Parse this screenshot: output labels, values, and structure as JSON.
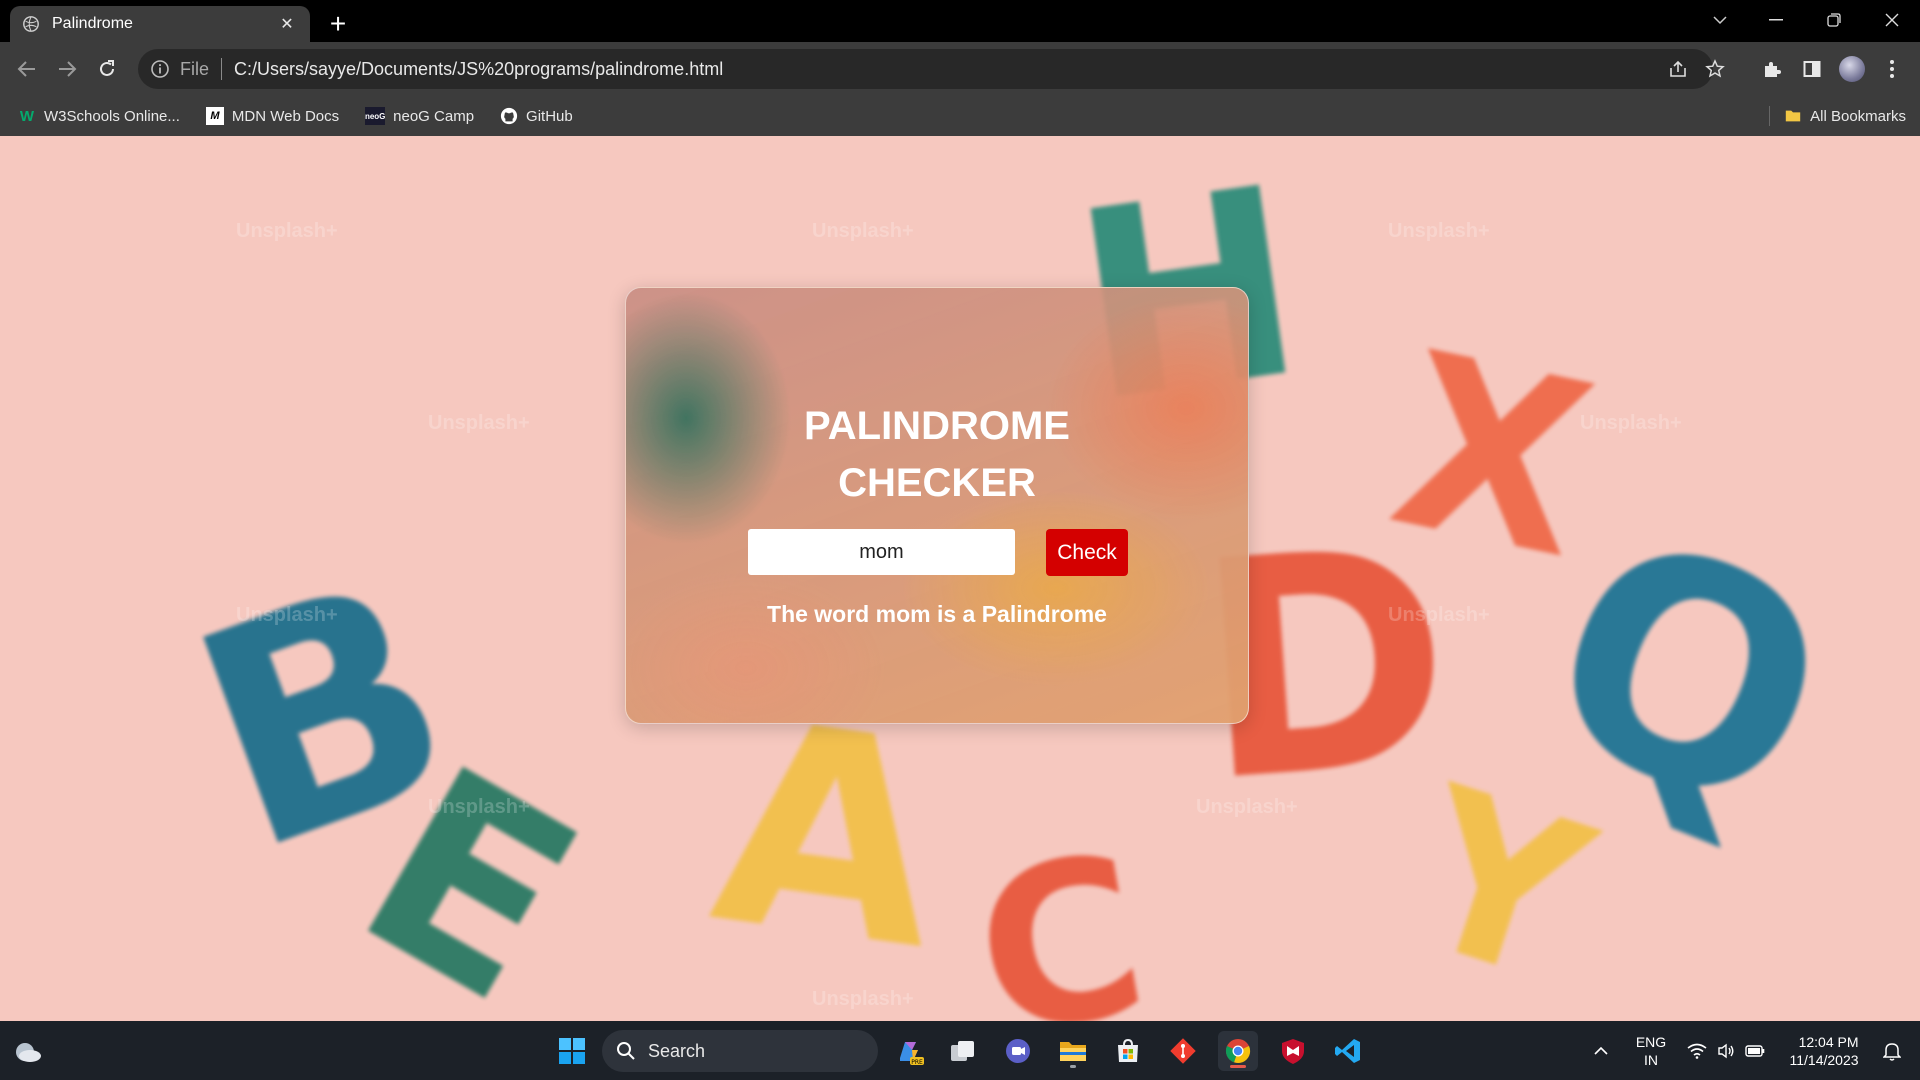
{
  "browser": {
    "tab_title": "Palindrome",
    "url_scheme": "File",
    "url": "C:/Users/sayye/Documents/JS%20programs/palindrome.html",
    "bookmarks": [
      {
        "label": "W3Schools Online...",
        "icon": "w3schools-icon"
      },
      {
        "label": "MDN Web Docs",
        "icon": "mdn-icon"
      },
      {
        "label": "neoG Camp",
        "icon": "neog-icon"
      },
      {
        "label": "GitHub",
        "icon": "github-icon"
      }
    ],
    "all_bookmarks_label": "All Bookmarks"
  },
  "page": {
    "title_line1": "PALINDROME",
    "title_line2": "CHECKER",
    "input_value": "mom",
    "button_label": "Check",
    "result": "The word mom is a Palindrome",
    "background_watermark": "Unsplash+",
    "background_letters": [
      "H",
      "B",
      "A",
      "D",
      "C",
      "X",
      "Y",
      "E",
      "Q"
    ],
    "accent_color": "#d40000"
  },
  "taskbar": {
    "search_label": "Search",
    "apps": [
      "windows-start-icon",
      "search-icon",
      "copilot-icon",
      "task-view-icon",
      "teams-icon",
      "file-explorer-icon",
      "microsoft-store-icon",
      "git-icon",
      "chrome-icon",
      "mcafee-icon",
      "vscode-icon"
    ],
    "language_line1": "ENG",
    "language_line2": "IN",
    "time": "12:04 PM",
    "date": "11/14/2023"
  }
}
